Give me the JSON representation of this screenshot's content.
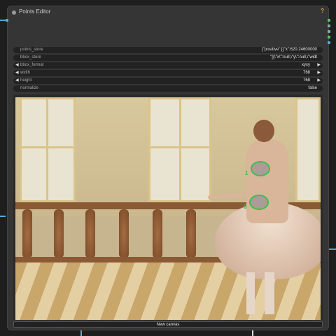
{
  "node": {
    "title": "Points Editor",
    "badge": "?",
    "colors": {
      "accent": "#35c24a",
      "link": "#5aa6d6"
    }
  },
  "widgets": [
    {
      "label": "points_store",
      "value": "{\"positive\":[{\"x\":620.24600000",
      "kind": "text"
    },
    {
      "label": "bbox_store",
      "value": "\"[{\\\"x\\\":null,\\\"y\\\":null,\\\"widt",
      "kind": "text"
    },
    {
      "label": "bbox_format",
      "value": "xyxy",
      "kind": "combo"
    },
    {
      "label": "width",
      "value": "768",
      "kind": "number"
    },
    {
      "label": "height",
      "value": "768",
      "kind": "number"
    },
    {
      "label": "normalize",
      "value": "false",
      "kind": "toggle"
    }
  ],
  "canvas": {
    "points": [
      {
        "label": "1"
      },
      {
        "label": "0"
      }
    ]
  },
  "new_canvas_label": "New canvas"
}
